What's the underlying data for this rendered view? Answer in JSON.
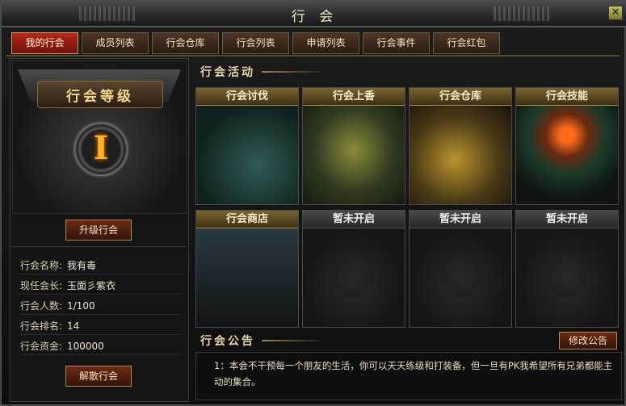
{
  "window": {
    "title": "行 会"
  },
  "tabs": [
    {
      "label": "我的行会",
      "active": true
    },
    {
      "label": "成员列表",
      "active": false
    },
    {
      "label": "行会仓库",
      "active": false
    },
    {
      "label": "行会列表",
      "active": false
    },
    {
      "label": "申请列表",
      "active": false
    },
    {
      "label": "行会事件",
      "active": false
    },
    {
      "label": "行会红包",
      "active": false
    }
  ],
  "left": {
    "level_title": "行会等级",
    "level_value": "I",
    "upgrade_label": "升级行会",
    "info": [
      {
        "label": "行会名称:",
        "value": "我有毒"
      },
      {
        "label": "现任会长:",
        "value": "玉面彡紫衣"
      },
      {
        "label": "行会人数:",
        "value": "1/100"
      },
      {
        "label": "行会排名:",
        "value": "14"
      },
      {
        "label": "行会资金:",
        "value": "100000"
      }
    ],
    "disband_label": "解散行会"
  },
  "activities": {
    "heading": "行会活动",
    "cards": [
      {
        "label": "行会讨伐",
        "locked": false,
        "art": "fight"
      },
      {
        "label": "行会上香",
        "locked": false,
        "art": "incense"
      },
      {
        "label": "行会仓库",
        "locked": false,
        "art": "store"
      },
      {
        "label": "行会技能",
        "locked": false,
        "art": "skill"
      },
      {
        "label": "行会商店",
        "locked": false,
        "art": "shop"
      },
      {
        "label": "暂未开启",
        "locked": true,
        "art": "locked"
      },
      {
        "label": "暂未开启",
        "locked": true,
        "art": "locked"
      },
      {
        "label": "暂未开启",
        "locked": true,
        "art": "locked"
      }
    ]
  },
  "notice": {
    "heading": "行会公告",
    "edit_label": "修改公告",
    "text": "1：本会不干预每一个朋友的生活，你可以天天练级和打装备，但一旦有PK我希望所有兄弟都能主动的集合。"
  },
  "colors": {
    "tab_active": "#b8281a",
    "card_header": "#7a6432",
    "medal_glow": "#ffb020"
  }
}
